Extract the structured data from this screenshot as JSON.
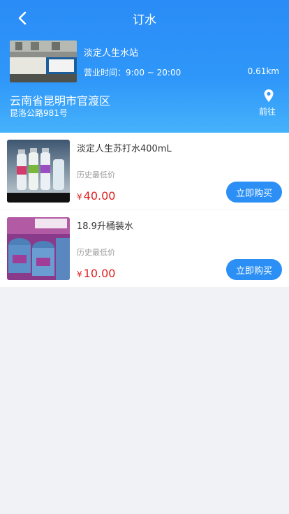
{
  "nav": {
    "title": "订水"
  },
  "store": {
    "name": "淡定人生水站",
    "hours_label": "营业时间：9:00 ~ 20:00",
    "distance": "0.61km",
    "address_main": "云南省昆明市官渡区",
    "address_sub": "昆洛公路981号",
    "go_label": "前往",
    "photo_sign_text": "淡定人生 自制水"
  },
  "products": [
    {
      "name": "淡定人生苏打水400mL",
      "history_label": "历史最低价",
      "currency": "¥",
      "price": "40.00",
      "buy_label": "立即购买"
    },
    {
      "name": "18.9升桶装水",
      "history_label": "历史最低价",
      "currency": "¥",
      "price": "10.00",
      "buy_label": "立即购买"
    }
  ],
  "colors": {
    "header_blue": "#2a8cf7",
    "button_blue": "#2b8ff5",
    "price_red": "#e02020",
    "background": "#f1f2f6"
  }
}
